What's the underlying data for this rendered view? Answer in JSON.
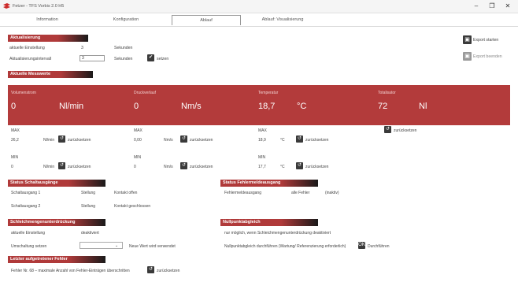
{
  "window": {
    "title": "Fetzer - TFS Vorbis 2.0 H5",
    "minimize": "–",
    "maximize": "❐",
    "close": "✕"
  },
  "tabs": [
    {
      "label": "Information"
    },
    {
      "label": "Konfiguration"
    },
    {
      "label": "Ablauf"
    },
    {
      "label": "Ablauf: Visualisierung"
    }
  ],
  "aktualisierung": {
    "header": "Aktualisierung",
    "current_label": "aktuelle Einstellung",
    "current_value": "3",
    "current_unit": "Sekunden",
    "interval_label": "Aktualisierungsintervall",
    "interval_value": "3",
    "interval_unit": "Sekunden",
    "apply_label": "setzen"
  },
  "export": {
    "start_label": "Export starten",
    "stop_label": "Export beenden"
  },
  "measurements": {
    "header": "Aktuelle Messwerte",
    "columns": [
      {
        "name": "Volumenstrom",
        "value": "0",
        "unit": "Nl/min",
        "max_label": "MAX",
        "max_value": "26,2",
        "max_unit": "Nl/min",
        "min_label": "MIN",
        "min_value": "0",
        "min_unit": "Nl/min"
      },
      {
        "name": "Druckverlauf",
        "value": "0",
        "unit": "Nm/s",
        "max_label": "MAX",
        "max_value": "0,00",
        "max_unit": "Nm/s",
        "min_label": "MIN",
        "min_value": "0",
        "min_unit": "Nm/s"
      },
      {
        "name": "Temperatur",
        "value": "18,7",
        "unit": "°C",
        "max_label": "MAX",
        "max_value": "18,9",
        "max_unit": "°C",
        "min_label": "MIN",
        "min_value": "17,7",
        "min_unit": "°C"
      },
      {
        "name": "Totalisator",
        "value": "72",
        "unit": "Nl"
      }
    ],
    "reset_label": "zurücksetzen"
  },
  "schalt": {
    "header": "Status Schaltausgänge",
    "rows": [
      {
        "name": "Schaltausgang 1",
        "state": "Stellung",
        "detail": "Kontakt offen"
      },
      {
        "name": "Schaltausgang 2",
        "state": "Stellung",
        "detail": "Kontakt geschlossen"
      }
    ]
  },
  "fehler": {
    "header": "Status Fehlermeldeausgang",
    "label": "Fehlermeldeausgang",
    "value": "alle Fehler",
    "detail": "(inaktiv)"
  },
  "schwingung": {
    "header": "Schleichmengenunterdrückung",
    "current_label": "aktuelle Einstellung",
    "current_value": "deaktiviert",
    "select_label": "Umschaltung setzen",
    "hint": "Neue Wert wird verwendet"
  },
  "nullpunkt": {
    "header": "Nullpunktabgleich",
    "text": "nur möglich, wenn Schleichmengenunterdrückung deaktiviert",
    "action_text": "Nullpunktabgleich durchführen (Wartung/ Referenzierung erforderlich)",
    "ok_label": "Durchführen"
  },
  "lastfehler": {
    "header": "Letzter aufgetretener Fehler",
    "text": "Fehler Nr. 68 – maximale Anzahl von Fehler-Einträgen überschritten",
    "reset_label": "zurücksetzen"
  },
  "colors": {
    "accent": "#b33b3b",
    "export_active": "#3a3a3a",
    "export_inactive": "#9a9a9a"
  }
}
